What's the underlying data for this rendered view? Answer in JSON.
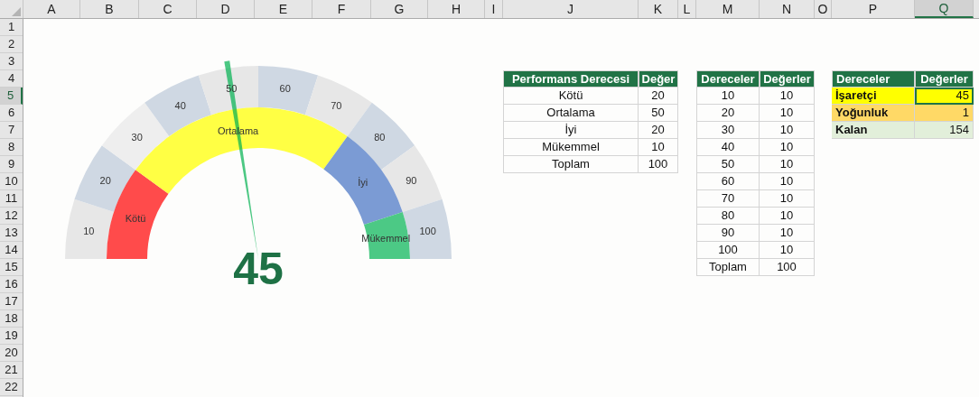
{
  "columns": [
    {
      "label": "A",
      "selected": false
    },
    {
      "label": "B",
      "selected": false
    },
    {
      "label": "C",
      "selected": false
    },
    {
      "label": "D",
      "selected": false
    },
    {
      "label": "E",
      "selected": false
    },
    {
      "label": "F",
      "selected": false
    },
    {
      "label": "G",
      "selected": false
    },
    {
      "label": "H",
      "selected": false
    },
    {
      "label": "I",
      "selected": false
    },
    {
      "label": "J",
      "selected": false
    },
    {
      "label": "K",
      "selected": false
    },
    {
      "label": "L",
      "selected": false
    },
    {
      "label": "M",
      "selected": false
    },
    {
      "label": "N",
      "selected": false
    },
    {
      "label": "O",
      "selected": false
    },
    {
      "label": "P",
      "selected": false
    },
    {
      "label": "Q",
      "selected": true
    }
  ],
  "rows": [
    {
      "label": "1",
      "selected": false
    },
    {
      "label": "2",
      "selected": false
    },
    {
      "label": "3",
      "selected": false
    },
    {
      "label": "4",
      "selected": false
    },
    {
      "label": "5",
      "selected": true
    },
    {
      "label": "6",
      "selected": false
    },
    {
      "label": "7",
      "selected": false
    },
    {
      "label": "8",
      "selected": false
    },
    {
      "label": "9",
      "selected": false
    },
    {
      "label": "10",
      "selected": false
    },
    {
      "label": "11",
      "selected": false
    },
    {
      "label": "12",
      "selected": false
    },
    {
      "label": "13",
      "selected": false
    },
    {
      "label": "14",
      "selected": false
    },
    {
      "label": "15",
      "selected": false
    },
    {
      "label": "16",
      "selected": false
    },
    {
      "label": "17",
      "selected": false
    },
    {
      "label": "18",
      "selected": false
    },
    {
      "label": "19",
      "selected": false
    },
    {
      "label": "20",
      "selected": false
    },
    {
      "label": "21",
      "selected": false
    },
    {
      "label": "22",
      "selected": false
    }
  ],
  "gauge": {
    "scale": [
      {
        "label": "10",
        "color": "#e7e7e7"
      },
      {
        "label": "20",
        "color": "#cfd8e3"
      },
      {
        "label": "30",
        "color": "#eeeeee"
      },
      {
        "label": "40",
        "color": "#cfd8e3"
      },
      {
        "label": "50",
        "color": "#e7e7e7"
      },
      {
        "label": "60",
        "color": "#cfd8e3"
      },
      {
        "label": "70",
        "color": "#e7e7e7"
      },
      {
        "label": "80",
        "color": "#cfd8e3"
      },
      {
        "label": "90",
        "color": "#e7e7e7"
      },
      {
        "label": "100",
        "color": "#cfd8e3"
      }
    ],
    "bands": [
      {
        "label": "Kötü",
        "color": "#ff4b4b"
      },
      {
        "label": "Ortalama",
        "color": "#ffff44"
      },
      {
        "label": "İyi",
        "color": "#7b9bd4"
      },
      {
        "label": "Mükemmel",
        "color": "#4cc985"
      }
    ],
    "needle": {
      "level": 0.45
    },
    "value": "45"
  },
  "performance_table": {
    "columns": [
      "Performans Derecesi",
      "Değer"
    ],
    "rows": [
      {
        "grade": "Kötü",
        "value": "20"
      },
      {
        "grade": "Ortalama",
        "value": "50"
      },
      {
        "grade": "İyi",
        "value": "20"
      },
      {
        "grade": "Mükemmel",
        "value": "10"
      },
      {
        "grade": "Toplam",
        "value": "100"
      }
    ]
  },
  "grades_table": {
    "columns": [
      "Dereceler",
      "Değerler"
    ],
    "rows": [
      {
        "grade": "10",
        "value": "10"
      },
      {
        "grade": "20",
        "value": "10"
      },
      {
        "grade": "30",
        "value": "10"
      },
      {
        "grade": "40",
        "value": "10"
      },
      {
        "grade": "50",
        "value": "10"
      },
      {
        "grade": "60",
        "value": "10"
      },
      {
        "grade": "70",
        "value": "10"
      },
      {
        "grade": "80",
        "value": "10"
      },
      {
        "grade": "90",
        "value": "10"
      },
      {
        "grade": "100",
        "value": "10"
      },
      {
        "grade": "Toplam",
        "value": "100"
      }
    ]
  },
  "pointer_table": {
    "columns": [
      "Dereceler",
      "Değerler"
    ],
    "rows": [
      {
        "label": "İşaretçi",
        "value": "45",
        "color": "#ffff00",
        "selected": true
      },
      {
        "label": "Yoğunluk",
        "value": "1",
        "color": "#ffd966",
        "selected": false
      },
      {
        "label": "Kalan",
        "value": "154",
        "color": "#e2efda",
        "selected": false
      }
    ]
  }
}
